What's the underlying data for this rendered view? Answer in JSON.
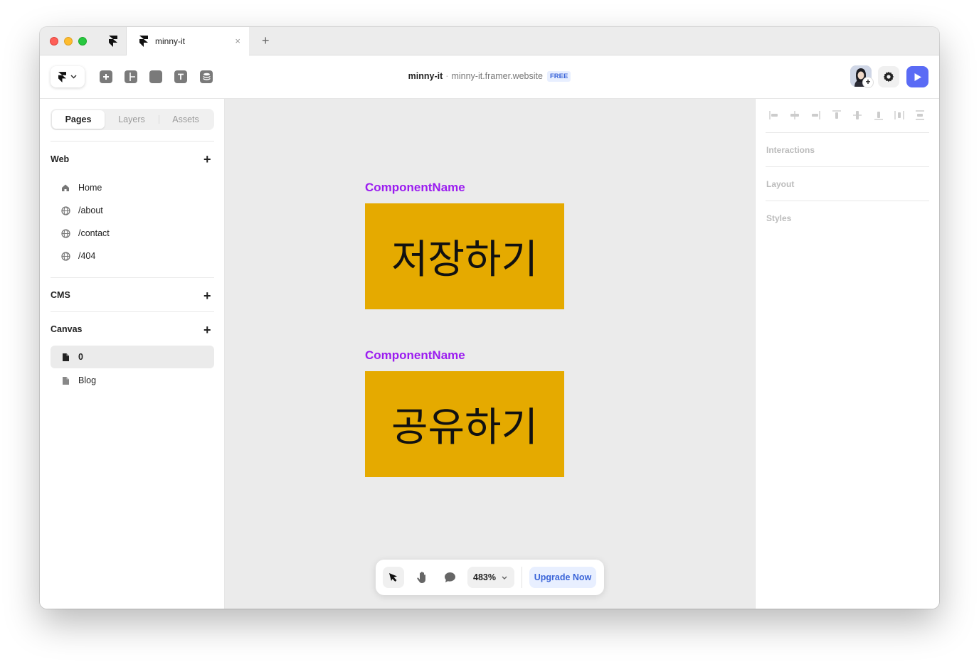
{
  "browser": {
    "tab_title": "minny-it",
    "tab_close": "×",
    "new_tab": "+"
  },
  "toolbar": {
    "project_name": "minny-it",
    "separator": "·",
    "domain": "minny-it.framer.website",
    "plan_badge": "FREE",
    "accent_color": "#5a6bf5"
  },
  "left_panel": {
    "tabs": [
      "Pages",
      "Layers",
      "Assets"
    ],
    "sections": {
      "web": {
        "title": "Web",
        "add": "+",
        "pages": [
          {
            "label": "Home",
            "icon": "home-icon"
          },
          {
            "label": "/about",
            "icon": "globe-icon"
          },
          {
            "label": "/contact",
            "icon": "globe-icon"
          },
          {
            "label": "/404",
            "icon": "globe-icon"
          }
        ]
      },
      "cms": {
        "title": "CMS",
        "add": "+"
      },
      "canvas": {
        "title": "Canvas",
        "add": "+",
        "pages": [
          {
            "label": "0",
            "icon": "file-icon",
            "active": true
          },
          {
            "label": "Blog",
            "icon": "file-icon",
            "active": false
          }
        ]
      }
    }
  },
  "canvas": {
    "background": "#ebebeb",
    "components": [
      {
        "name": "ComponentName",
        "text": "저장하기",
        "fill": "#e5aa00"
      },
      {
        "name": "ComponentName",
        "text": "공유하기",
        "fill": "#e5aa00"
      }
    ],
    "bottom_bar": {
      "zoom": "483%",
      "upgrade": "Upgrade Now"
    }
  },
  "right_panel": {
    "sections": [
      "Interactions",
      "Layout",
      "Styles"
    ]
  }
}
